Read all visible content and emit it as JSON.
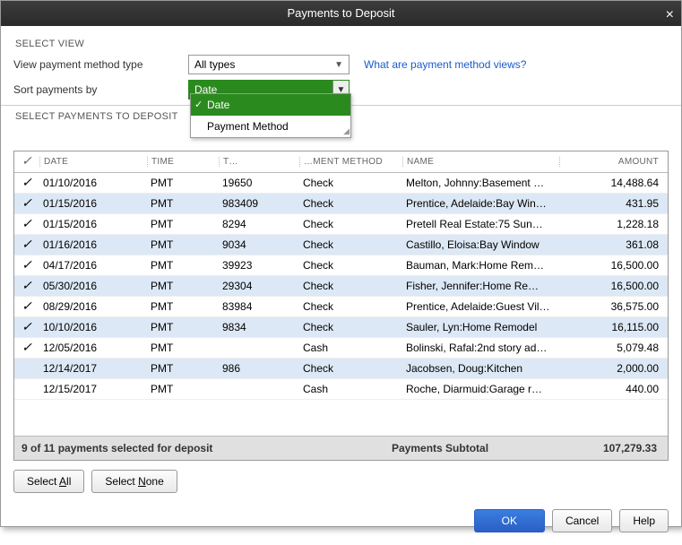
{
  "title": "Payments to Deposit",
  "selectView": {
    "section_label": "SELECT VIEW",
    "view_label": "View payment method type",
    "view_value": "All types",
    "link_text": "What are payment method views?",
    "sort_label": "Sort payments by",
    "sort_value": "Date",
    "sort_options": [
      "Date",
      "Payment Method"
    ]
  },
  "selectPayments": {
    "section_label": "SELECT PAYMENTS TO DEPOSIT",
    "headers": {
      "chk": "✓",
      "date": "DATE",
      "time": "TIME",
      "nbr": "T…",
      "method": "…MENT METHOD",
      "name": "NAME",
      "amount": "AMOUNT"
    },
    "rows": [
      {
        "chk": "✓",
        "date": "01/10/2016",
        "time": "PMT",
        "nbr": "19650",
        "method": "Check",
        "name": "Melton, Johnny:Basement …",
        "amt": "14,488.64"
      },
      {
        "chk": "✓",
        "date": "01/15/2016",
        "time": "PMT",
        "nbr": "983409",
        "method": "Check",
        "name": "Prentice, Adelaide:Bay Win…",
        "amt": "431.95"
      },
      {
        "chk": "✓",
        "date": "01/15/2016",
        "time": "PMT",
        "nbr": "8294",
        "method": "Check",
        "name": "Pretell Real Estate:75 Sun…",
        "amt": "1,228.18"
      },
      {
        "chk": "✓",
        "date": "01/16/2016",
        "time": "PMT",
        "nbr": "9034",
        "method": "Check",
        "name": "Castillo, Eloisa:Bay Window",
        "amt": "361.08"
      },
      {
        "chk": "✓",
        "date": "04/17/2016",
        "time": "PMT",
        "nbr": "39923",
        "method": "Check",
        "name": "Bauman, Mark:Home Rem…",
        "amt": "16,500.00"
      },
      {
        "chk": "✓",
        "date": "05/30/2016",
        "time": "PMT",
        "nbr": "29304",
        "method": "Check",
        "name": "Fisher, Jennifer:Home Re…",
        "amt": "16,500.00"
      },
      {
        "chk": "✓",
        "date": "08/29/2016",
        "time": "PMT",
        "nbr": "83984",
        "method": "Check",
        "name": "Prentice, Adelaide:Guest Vil…",
        "amt": "36,575.00"
      },
      {
        "chk": "✓",
        "date": "10/10/2016",
        "time": "PMT",
        "nbr": "9834",
        "method": "Check",
        "name": "Sauler, Lyn:Home Remodel",
        "amt": "16,115.00"
      },
      {
        "chk": "✓",
        "date": "12/05/2016",
        "time": "PMT",
        "nbr": "",
        "method": "Cash",
        "name": "Bolinski, Rafal:2nd story ad…",
        "amt": "5,079.48"
      },
      {
        "chk": "",
        "date": "12/14/2017",
        "time": "PMT",
        "nbr": "986",
        "method": "Check",
        "name": "Jacobsen, Doug:Kitchen",
        "amt": "2,000.00"
      },
      {
        "chk": "",
        "date": "12/15/2017",
        "time": "PMT",
        "nbr": "",
        "method": "Cash",
        "name": "Roche, Diarmuid:Garage r…",
        "amt": "440.00"
      }
    ]
  },
  "footer": {
    "status": "9 of 11 payments selected for deposit",
    "subtotal_label": "Payments Subtotal",
    "subtotal_value": "107,279.33"
  },
  "buttons": {
    "select_all": "Select All",
    "select_none": "Select None",
    "ok": "OK",
    "cancel": "Cancel",
    "help": "Help"
  }
}
